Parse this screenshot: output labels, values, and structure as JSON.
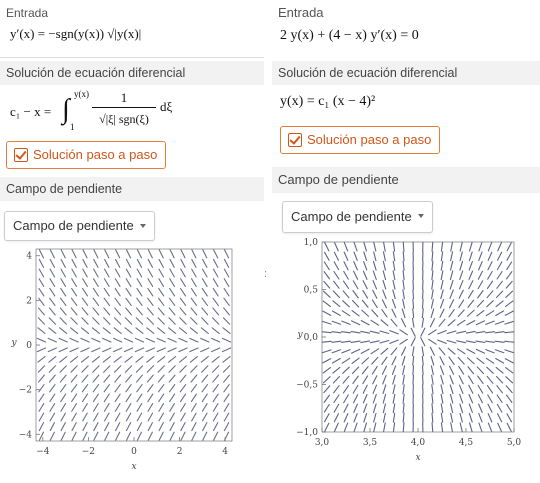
{
  "left": {
    "input_label": "Entrada",
    "input_formula": "y′(x) = −sgn(y(x)) √|y(x)|",
    "solution_header": "Solución de ecuación diferencial",
    "solution_formula_lhs": "c₁ − x =",
    "solution_int_upper": "y(x)",
    "solution_int_lower": "1",
    "solution_num": "1",
    "solution_den": "√|ξ| sgn(ξ)",
    "solution_dxi": "dξ",
    "step_button": "Solución paso a paso",
    "slope_header": "Campo de pendiente",
    "dropdown": "Campo de pendiente",
    "plot": {
      "xlabel": "x",
      "ylabel": "y",
      "xticks": [
        "−4",
        "−2",
        "0",
        "2",
        "4"
      ],
      "yticks": [
        "4",
        "2",
        "0",
        "−2",
        "−4"
      ],
      "xlim": [
        -4.3,
        4.3
      ],
      "ylim": [
        -4.3,
        4.3
      ]
    }
  },
  "right": {
    "input_label": "Entrada",
    "input_formula": "2 y(x) + (4 − x) y′(x) = 0",
    "solution_header": "Solución de ecuación diferencial",
    "solution_formula": "y(x) = c₁ (x − 4)²",
    "step_button": "Solución paso a paso",
    "slope_header": "Campo de pendiente",
    "dropdown": "Campo de pendiente",
    "plot": {
      "xlabel": "x",
      "ylabel": "y",
      "xticks": [
        "3,0",
        "3,5",
        "4,0",
        "4,5",
        "5,0"
      ],
      "yticks": [
        "1,0",
        "0,5",
        "0,0",
        "−0,5",
        "−1,0"
      ],
      "xlim": [
        3.0,
        5.0
      ],
      "ylim": [
        -1.0,
        1.0
      ]
    }
  },
  "colors": {
    "accent": "#d0561a",
    "field_left": "#6b6f86",
    "field_right": "#5c6488",
    "band": "#f2f2f2"
  },
  "icons": {
    "step_check": "checkbox-check-icon",
    "dropdown_caret": "caret-down-icon"
  }
}
